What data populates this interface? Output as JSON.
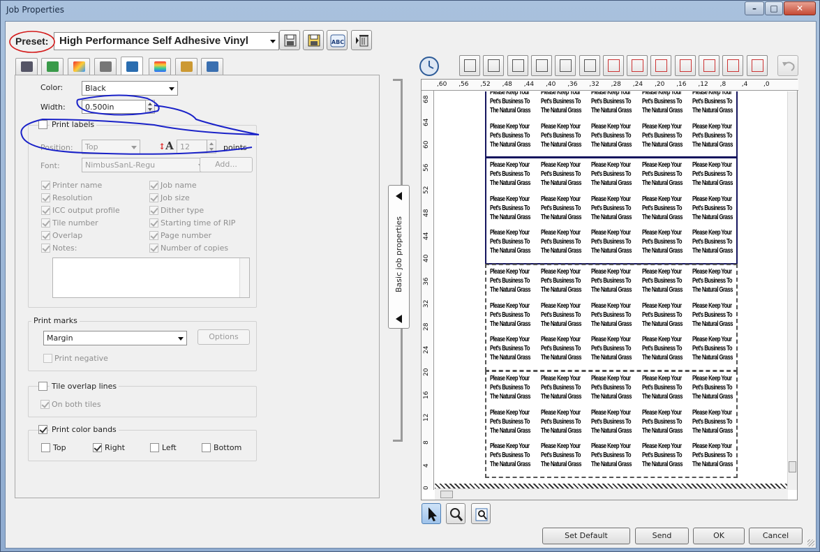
{
  "window": {
    "title": "Job Properties"
  },
  "preset": {
    "label": "Preset:",
    "value": "High Performance Self Adhesive Vinyl"
  },
  "panel": {
    "color": {
      "label": "Color:",
      "value": "Black"
    },
    "width": {
      "label": "Width:",
      "value": "0.500in"
    },
    "print_labels": {
      "label": "Print labels",
      "checked": false
    },
    "position": {
      "label": "Position:",
      "value": "Top"
    },
    "size": {
      "value": "12",
      "unit": "points"
    },
    "font": {
      "label": "Font:",
      "value": "NimbusSanL-Regu",
      "add_button": "Add..."
    },
    "label_options_left": [
      {
        "label": "Printer name",
        "checked": true
      },
      {
        "label": "Resolution",
        "checked": true
      },
      {
        "label": "ICC output profile",
        "checked": true
      },
      {
        "label": "Tile number",
        "checked": true
      },
      {
        "label": "Overlap",
        "checked": true
      },
      {
        "label": "Notes:",
        "checked": true
      }
    ],
    "label_options_right": [
      {
        "label": "Job name",
        "checked": true
      },
      {
        "label": "Job size",
        "checked": true
      },
      {
        "label": "Dither type",
        "checked": true
      },
      {
        "label": "Starting time of RIP",
        "checked": true
      },
      {
        "label": "Page number",
        "checked": true
      },
      {
        "label": "Number of copies",
        "checked": true
      }
    ],
    "print_marks": {
      "title": "Print marks",
      "value": "Margin",
      "options_button": "Options",
      "print_negative": "Print negative"
    },
    "tile_overlap": {
      "label": "Tile overlap lines",
      "on_both_tiles": "On both tiles"
    },
    "color_bands": {
      "label": "Print color bands",
      "options": [
        {
          "label": "Top",
          "checked": false
        },
        {
          "label": "Right",
          "checked": true
        },
        {
          "label": "Left",
          "checked": false
        },
        {
          "label": "Bottom",
          "checked": false
        }
      ]
    }
  },
  "splitter": {
    "label": "Basic job properties"
  },
  "preview": {
    "h_ticks": [
      ",60",
      ",56",
      ",52",
      ",48",
      ",44",
      ",40",
      ",36",
      ",32",
      ",28",
      ",24",
      ",20",
      ",16",
      ",12",
      ",8",
      ",4",
      ",0"
    ],
    "v_ticks": [
      "68",
      "64",
      "60",
      "56",
      "52",
      "48",
      "44",
      "40",
      "36",
      "32",
      "28",
      "24",
      "20",
      "16",
      "12",
      "8",
      "4",
      "0"
    ],
    "label_text": [
      "Please Keep Your",
      "Pet's Business To",
      "The Natural Grass"
    ]
  },
  "buttons": {
    "set_default": "Set Default",
    "send": "Send",
    "ok": "OK",
    "cancel": "Cancel"
  },
  "icons": [
    "save-icon",
    "save-as-icon",
    "spell-check-icon",
    "delete-icon",
    "clock-icon",
    "select-arrow-icon",
    "zoom-icon",
    "zoom-fit-icon"
  ]
}
